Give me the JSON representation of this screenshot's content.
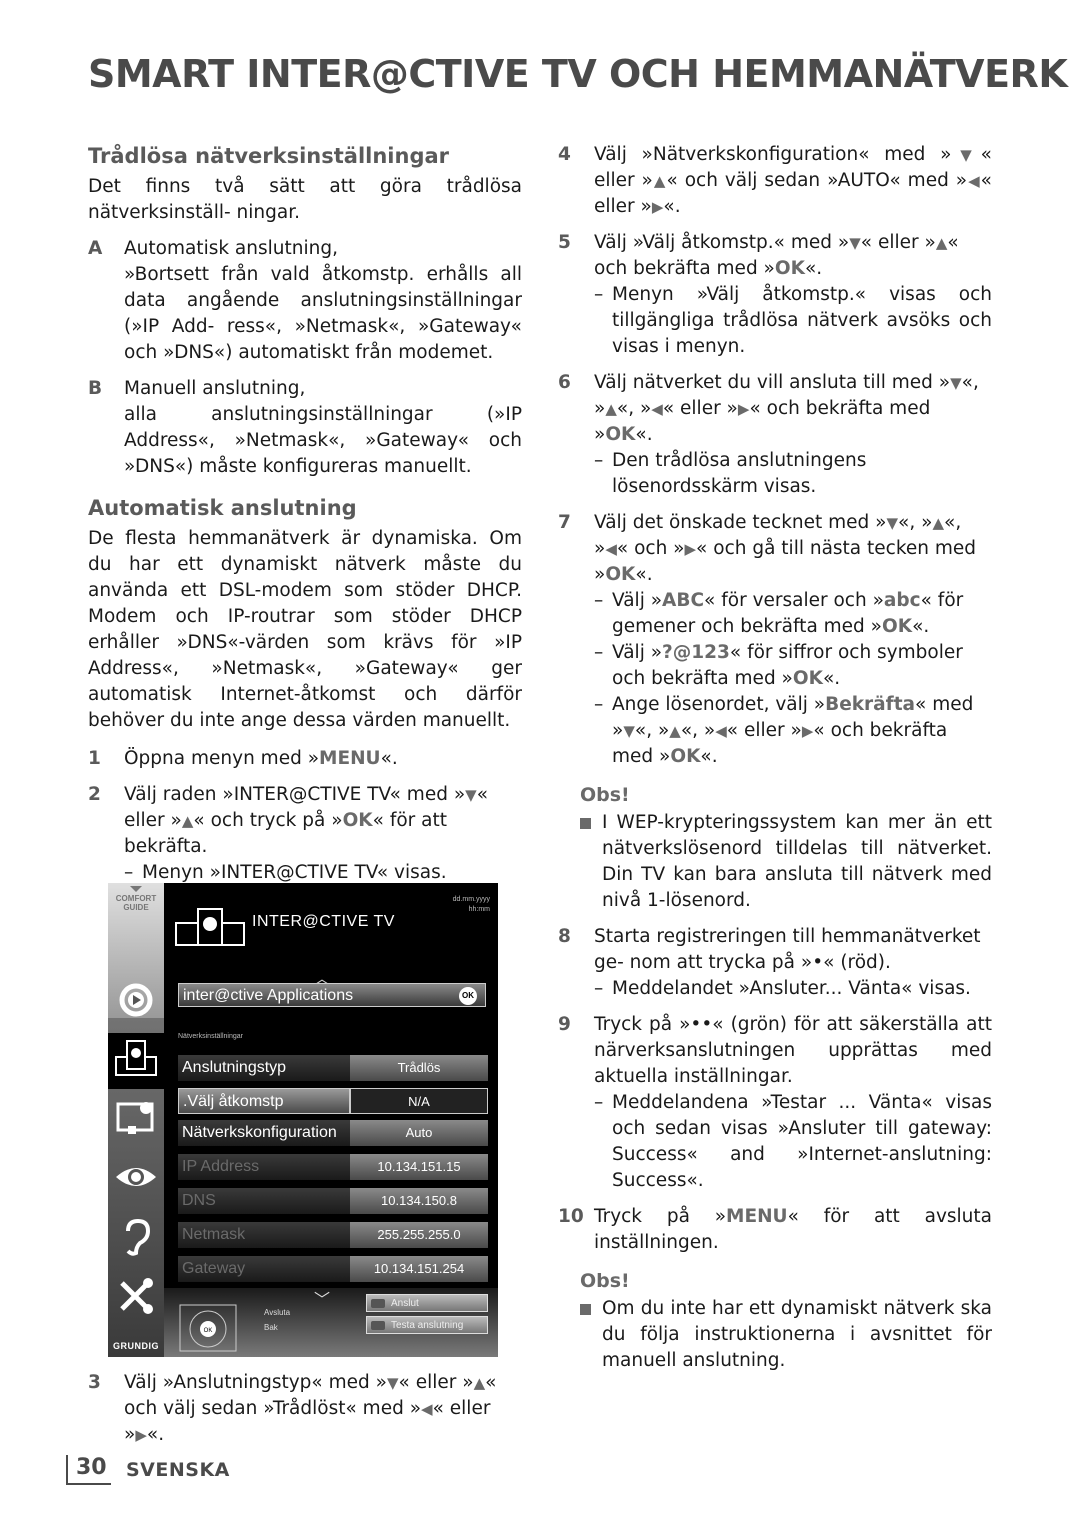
{
  "page_title": "SMART INTER@CTIVE TV OCH HEMMANÄTVERK",
  "left": {
    "section1": {
      "heading": "Trådlösa nätverksinställningar",
      "intro": "Det finns två sätt att göra trådlösa nätverksinställ- ningar.",
      "items": [
        {
          "label": "A",
          "title": "Automatisk anslutning,",
          "text": "»Bortsett från vald åtkomstp. erhålls all data angående anslutningsinställningar (»IP Add- ress«, »Netmask«, »Gateway« och »DNS«) automatiskt från modemet."
        },
        {
          "label": "B",
          "title": "Manuell anslutning,",
          "text": "alla anslutningsinställningar (»IP Address«, »Netmask«, »Gateway« och »DNS«) måste konfigureras manuellt."
        }
      ]
    },
    "section2": {
      "heading": "Automatisk anslutning",
      "intro": "De flesta hemmanätverk är dynamiska. Om du har ett dynamiskt nätverk måste du använda ett DSL-modem som stöder DHCP. Modem och IP-routrar som stöder DHCP erhåller »DNS«-värden som krävs för »IP Address«, »Netmask«, »Gateway« ger automatisk Internet-åtkomst och därför behöver du inte ange dessa värden manuellt.",
      "step1": {
        "num": "1",
        "pre": "Öppna menyn med »",
        "key": "MENU",
        "post": "«."
      },
      "step2": {
        "num": "2",
        "a": "Välj raden »INTER@CTIVE TV« med »",
        "b": "« eller »",
        "c": "« och tryck på »",
        "key": "OK",
        "d": "« för att bekräfta.",
        "sub": "Menyn »INTER@CTIVE TV« visas."
      },
      "step3": {
        "num": "3",
        "a": "Välj »Anslutningstyp« med »",
        "b": "« eller »",
        "c": "« och välj sedan »Trådlöst« med »",
        "d": "« eller »",
        "e": "«."
      }
    }
  },
  "tv": {
    "comfort_guide": "COMFORT GUIDE",
    "date": "dd.mm.yyyy",
    "time": "hh:mm",
    "title": "INTER@CTIVE TV",
    "app_row": "inter@ctive Applications",
    "ok": "OK",
    "section_label": "Nätverksinställningar",
    "rows": [
      {
        "name": "Anslutningstyp",
        "value": "Trådlös"
      },
      {
        "name": ".Välj åtkomstp",
        "value": "N/A"
      },
      {
        "name": "Nätverkskonfiguration",
        "value": "Auto"
      },
      {
        "name": "IP Address",
        "value": "10.134.151.15"
      },
      {
        "name": "DNS",
        "value": "10.134.150.8"
      },
      {
        "name": "Netmask",
        "value": "255.255.255.0"
      },
      {
        "name": "Gateway",
        "value": "10.134.151.254"
      }
    ],
    "legend_exit": "Avsluta",
    "legend_back": "Bak",
    "btn_connect": "Anslut",
    "btn_test": "Testa anslutning",
    "brand": "GRUNDIG"
  },
  "right": {
    "step4": {
      "num": "4",
      "a": "Välj »Nätverkskonfiguration« med »",
      "b": "« eller »",
      "c": "« och välj sedan »AUTO« med »",
      "d": "« eller »",
      "e": "«."
    },
    "step5": {
      "num": "5",
      "a": "Välj »Välj åtkomstp.« med »",
      "b": "« eller »",
      "c": "« och bekräfta med »",
      "key": "OK",
      "d": "«.",
      "sub": "Menyn »Välj åtkomstp.« visas och tillgängliga trådlösa nätverk avsöks och visas i menyn."
    },
    "step6": {
      "num": "6",
      "a": "Välj nätverket du vill ansluta till med »",
      "b": "«, »",
      "c": "«, »",
      "d": "« eller »",
      "e": "« och bekräfta med »",
      "key": "OK",
      "f": "«.",
      "sub": "Den trådlösa anslutningens lösenordsskärm visas."
    },
    "step7": {
      "num": "7",
      "a": "Välj det önskade tecknet med »",
      "b": "«, »",
      "c": "«, »",
      "d": "« och »",
      "e": "« och gå till nästa tecken med »",
      "key": "OK",
      "f": "«.",
      "sub1_a": "Välj »",
      "sub1_key1": "ABC",
      "sub1_b": "« för versaler och »",
      "sub1_key2": "abc",
      "sub1_c": "« för gemener och bekräfta med »",
      "sub1_d": "«.",
      "sub2_a": "Välj »",
      "sub2_key": "?@123",
      "sub2_b": "« för siffror och symboler och bekräfta med »",
      "sub2_c": "«.",
      "sub3_a": "Ange lösenordet, välj »",
      "sub3_key": "Bekräfta",
      "sub3_b": "« med »",
      "sub3_c": "«, »",
      "sub3_d": "«, »",
      "sub3_e": "« eller »",
      "sub3_f": "« och bekräfta med »",
      "sub3_g": "«."
    },
    "obs1_title": "Obs!",
    "obs1_text": "I WEP-krypteringssystem kan mer än ett nätverkslösenord tilldelas till nätverket. Din TV kan bara ansluta till nätverk med nivå 1-lösenord.",
    "step8": {
      "num": "8",
      "text": "Starta registreringen till hemmanätverket ge- nom att trycka på »•« (röd).",
      "sub": "Meddelandet  »Ansluter... Vänta« visas."
    },
    "step9": {
      "num": "9",
      "text": "Tryck på »••« (grön) för att säkerställa att närverksanslutningen upprättas med aktuella inställningar.",
      "sub": "Meddelandena »Testar ... Vänta« visas och sedan visas »Ansluter till gateway: Success« and »Internet-anslutning: Success«."
    },
    "step10": {
      "num": "10",
      "a": "Tryck på »",
      "key": "MENU",
      "b": "« för att avsluta inställningen."
    },
    "obs2_title": "Obs!",
    "obs2_text": "Om du inte har ett dynamiskt nätverk ska du följa instruktionerna i avsnittet för manuell anslutning."
  },
  "icons": {
    "down": "▼",
    "up": "▲",
    "left": "◀",
    "right": "▶",
    "dash": "–",
    "caret_up": "︿",
    "caret_down": "﹀"
  },
  "footer": {
    "page_number": "30",
    "language": "SVENSKA"
  }
}
